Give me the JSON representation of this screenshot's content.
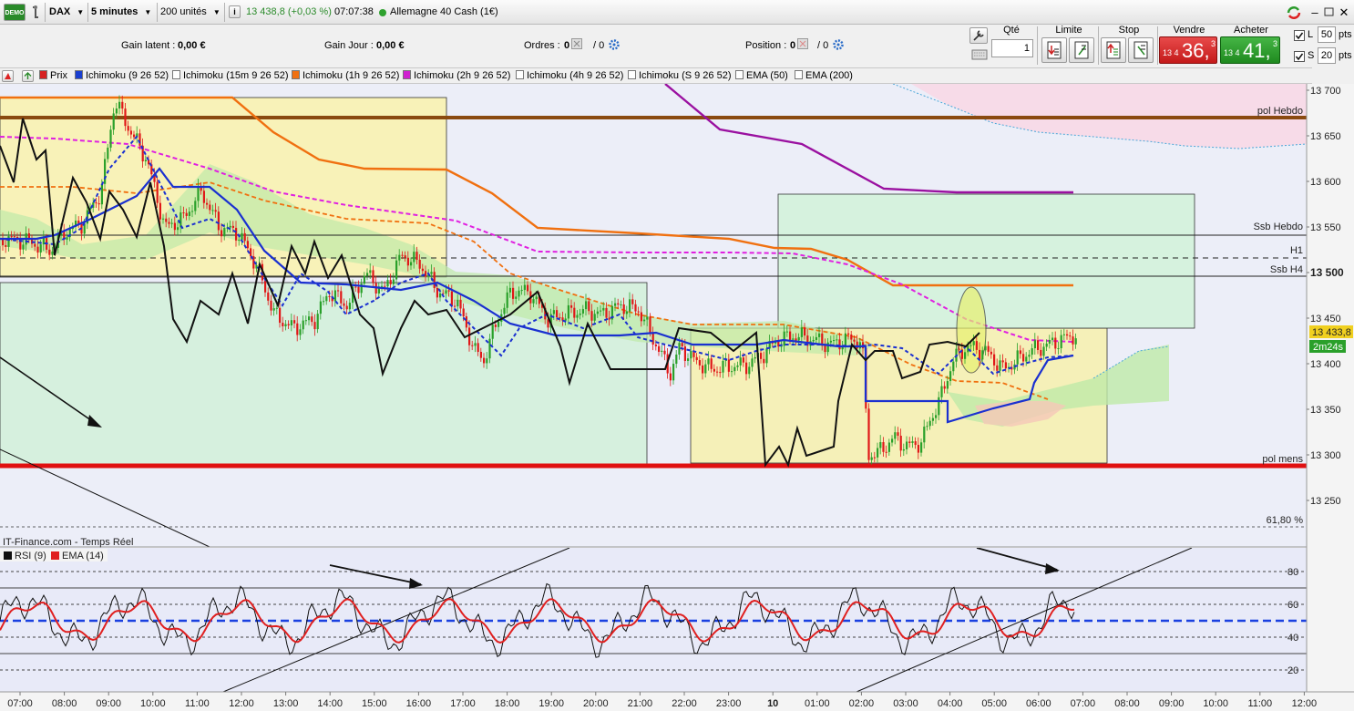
{
  "toolbar": {
    "demo_badge": "DEMO",
    "instrument": "DAX",
    "timeframe": "5 minutes",
    "units": "200 unités",
    "price_change": "13 438,8 (+0,03 %)",
    "time": "07:07:38",
    "market_name": "Allemagne 40 Cash (1€)",
    "status_color": "#2ea12e"
  },
  "info": {
    "gain_latent_label": "Gain latent :",
    "gain_latent_value": "0,00 €",
    "gain_jour_label": "Gain Jour :",
    "gain_jour_value": "0,00 €",
    "ordres_label": "Ordres :",
    "ordres_a": "0",
    "ordres_b": "/ 0",
    "position_label": "Position :",
    "position_a": "0",
    "position_b": "/ 0"
  },
  "trade": {
    "qty_label": "Qté",
    "qty_value": "1",
    "limit_label": "Limite",
    "stop_label": "Stop",
    "sell_label": "Vendre",
    "buy_label": "Acheter",
    "sell_small": "13 4",
    "sell_big": "36,",
    "sell_sup": "3",
    "buy_small": "13 4",
    "buy_big": "41,",
    "buy_sup": "3",
    "l_label": "L",
    "l_value": "50",
    "s_label": "S",
    "s_value": "20",
    "pts": "pts"
  },
  "indicators": [
    {
      "label": "Prix",
      "color": "#d62020"
    },
    {
      "label": "Ichimoku (9 26 52)",
      "color": "#1a3fd0"
    },
    {
      "label": "Ichimoku (15m 9 26 52)",
      "color": "#ffffff"
    },
    {
      "label": "Ichimoku (1h 9 26 52)",
      "color": "#f07010"
    },
    {
      "label": "Ichimoku (2h 9 26 52)",
      "color": "#d020d0"
    },
    {
      "label": "Ichimoku (4h 9 26 52)",
      "color": "#ffffff"
    },
    {
      "label": "Ichimoku (S 9 26 52)",
      "color": "#ffffff"
    },
    {
      "label": "EMA (50)",
      "color": "#ffffff"
    },
    {
      "label": "EMA (200)",
      "color": "#ffffff"
    }
  ],
  "chart": {
    "source_label": "IT-Finance.com - Temps Réel",
    "price_labels": [
      "13 700",
      "13 650",
      "13 600",
      "13 550",
      "13 500",
      "13 450",
      "13 400",
      "13 350",
      "13 300",
      "13 250"
    ],
    "current_price": "13 433,8",
    "countdown": "2m24s",
    "levels": {
      "pol_hebdo": "pol Hebdo",
      "ssb_hebdo": "Ssb Hebdo",
      "h1": "H1",
      "ssb_h4": "Ssb H4",
      "pol_mens": "pol mens",
      "fib": "61,80 %"
    },
    "time_labels": [
      "07:00",
      "08:00",
      "09:00",
      "10:00",
      "11:00",
      "12:00",
      "13:00",
      "14:00",
      "15:00",
      "16:00",
      "17:00",
      "18:00",
      "19:00",
      "20:00",
      "21:00",
      "22:00",
      "23:00",
      "10",
      "01:00",
      "02:00",
      "03:00",
      "04:00",
      "05:00",
      "06:00",
      "07:00",
      "08:00",
      "09:00",
      "10:00",
      "11:00",
      "12:00"
    ]
  },
  "rsi": {
    "rsi_label": "RSI (9)",
    "ema_label": "EMA (14)",
    "levels": [
      "80",
      "60",
      "40",
      "20"
    ]
  }
}
